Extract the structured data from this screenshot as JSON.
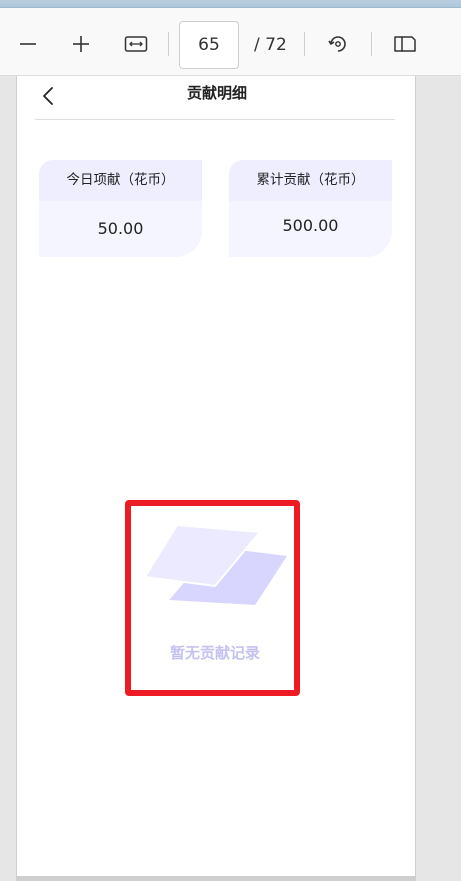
{
  "toolbar": {
    "current_page": "65",
    "total_pages": "/ 72",
    "icons": [
      "zoom-out-icon",
      "zoom-in-icon",
      "fit-width-icon",
      "rotate-icon",
      "two-page-view-icon"
    ]
  },
  "header": {
    "title": "贡献明细"
  },
  "cards": [
    {
      "label": "今日项献（花币）",
      "value": "50.00"
    },
    {
      "label": "累计贡献（花币）",
      "value": "500.00"
    }
  ],
  "empty_state": {
    "message": "暂无贡献记录"
  },
  "colors": {
    "accent": "#c5c2f2",
    "card_bg": "#f5f5ff",
    "highlight": "#ed1c24"
  }
}
